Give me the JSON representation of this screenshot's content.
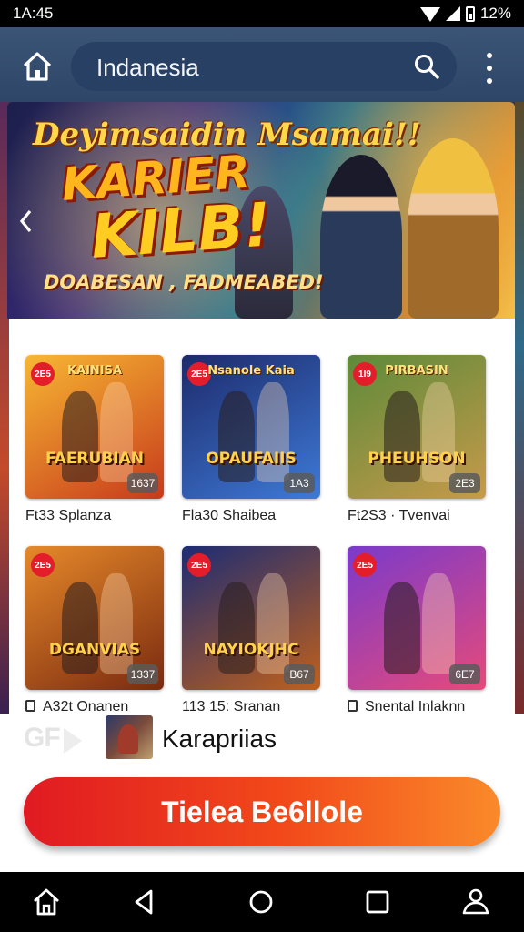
{
  "status_bar": {
    "time": "1A:45",
    "battery": "12%"
  },
  "app_bar": {
    "search_value": "Indanesia"
  },
  "banner": {
    "title": "Deyimsaidin Msamai!!",
    "line1": "KARIER",
    "line2": "KILB!",
    "tagline": "DOABESAN , FADMEABED!"
  },
  "games": [
    {
      "badge": "2E5",
      "title": "KAINISA",
      "subtitle": "FAERUBIAN",
      "count": "1637",
      "caption": "Ft33 Splanza",
      "colors": [
        "#f7b733",
        "#c73a1c"
      ]
    },
    {
      "badge": "2E5",
      "title": "Nsanole Kaia",
      "subtitle": "OPAUFAIIS",
      "count": "1A3",
      "caption": "Fla30 Shaibea",
      "colors": [
        "#1d2a6a",
        "#3e7ad8"
      ]
    },
    {
      "badge": "1I9",
      "title": "PIRBASIN",
      "subtitle": "PHEUHSON",
      "count": "2E3",
      "caption": "Ft2S3 · Tvenvai",
      "colors": [
        "#5c8a3a",
        "#c79a4a"
      ]
    },
    {
      "badge": "2E5",
      "title": "",
      "subtitle": "DGANVIAS",
      "count": "1337",
      "caption": "A32t Onanen",
      "colors": [
        "#e6892a",
        "#7a2a10"
      ]
    },
    {
      "badge": "2E5",
      "title": "",
      "subtitle": "NAYIOKJHC",
      "count": "B67",
      "caption": "113 15: Sranan",
      "colors": [
        "#1c2c74",
        "#c0601c"
      ]
    },
    {
      "badge": "2E5",
      "title": "",
      "subtitle": "",
      "count": "6E7",
      "caption": "Snental Inlaknn",
      "colors": [
        "#7a3acb",
        "#e64a7a"
      ]
    }
  ],
  "featured": {
    "logo": "GF",
    "label": "Karapriias"
  },
  "cta": {
    "label": "Tielea Be6llole"
  }
}
